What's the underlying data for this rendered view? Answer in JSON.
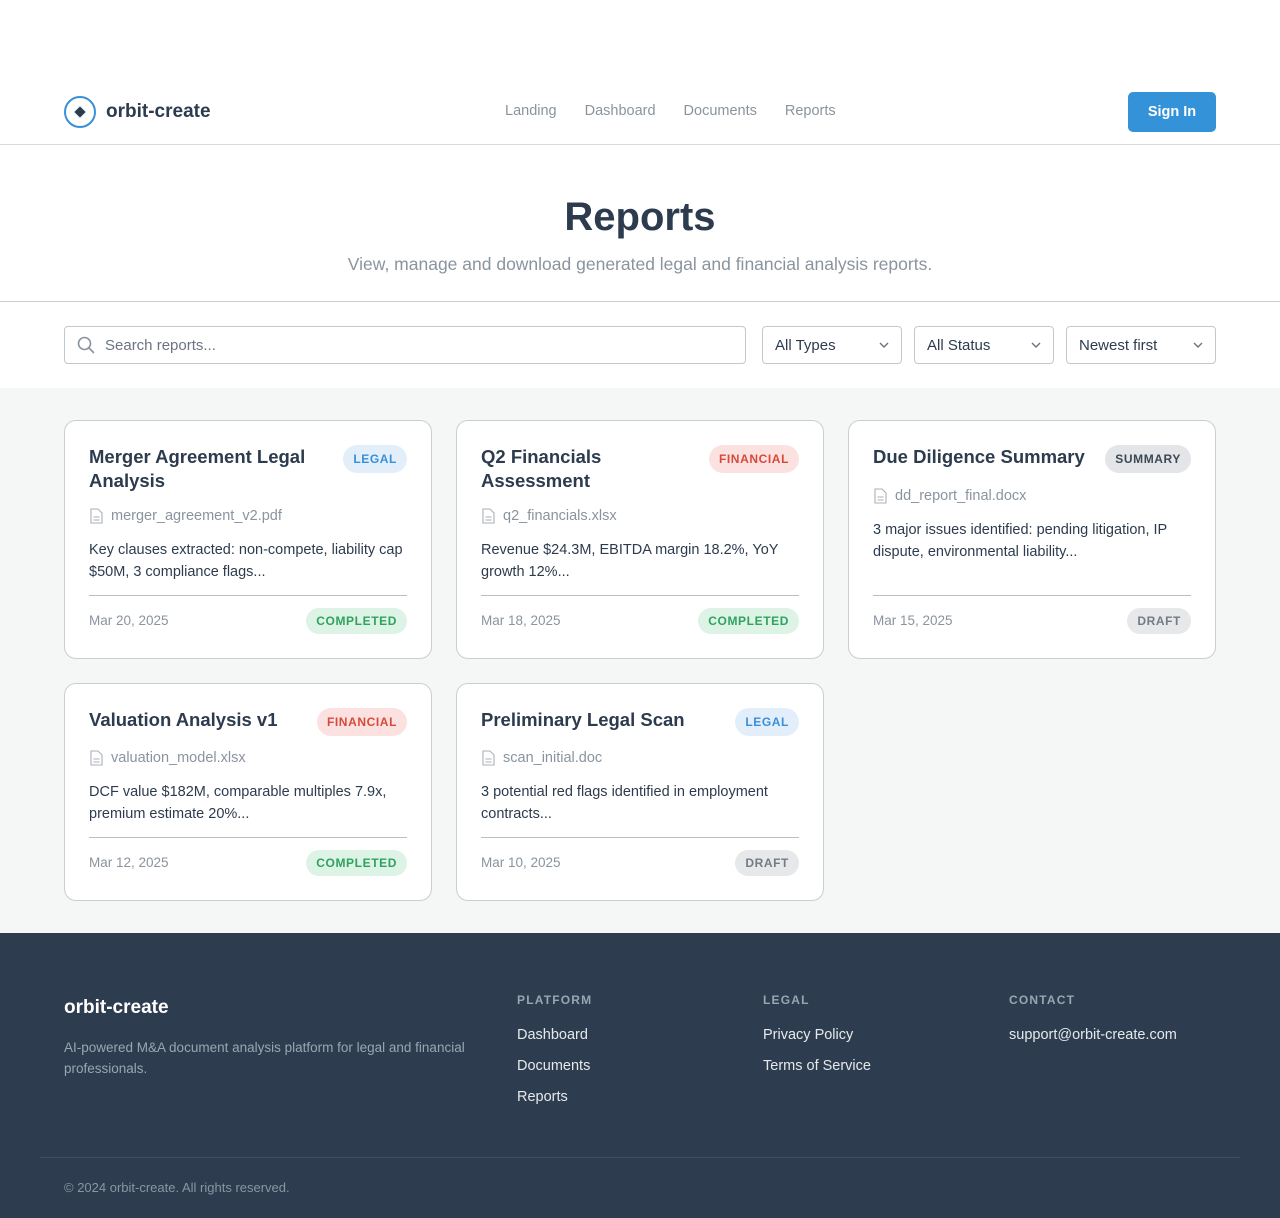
{
  "brand": {
    "name": "orbit-create",
    "accent": "#3492d9"
  },
  "nav": {
    "items": [
      "Landing",
      "Dashboard",
      "Documents",
      "Reports"
    ]
  },
  "header": {
    "signin_label": "Sign In"
  },
  "hero": {
    "title": "Reports",
    "subtitle": "View, manage and download generated legal and financial analysis reports."
  },
  "filters": {
    "search_placeholder": "Search reports...",
    "type_value": "All Types",
    "status_value": "All Status",
    "sort_value": "Newest first"
  },
  "reports": [
    {
      "title_line1": "Merger Agreement Legal",
      "title_line2": "Analysis",
      "badge": "LEGAL",
      "file": "merger_agreement_v2.pdf",
      "desc_line1": "Key clauses extracted: non-compete, liability cap",
      "desc_line2": "$50M, 3 compliance flags...",
      "date": "Mar 20, 2025",
      "status": "COMPLETED"
    },
    {
      "title_line1": "Q2 Financials",
      "title_line2": "Assessment",
      "badge": "FINANCIAL",
      "file": "q2_financials.xlsx",
      "desc_line1": "Revenue $24.3M, EBITDA margin 18.2%, YoY",
      "desc_line2": "growth 12%...",
      "date": "Mar 18, 2025",
      "status": "COMPLETED"
    },
    {
      "title_line1": "Due Diligence Summary",
      "title_line2": "",
      "badge": "SUMMARY",
      "file": "dd_report_final.docx",
      "desc_line1": "3 major issues identified: pending litigation, IP",
      "desc_line2": "dispute, environmental liability...",
      "date": "Mar 15, 2025",
      "status": "DRAFT"
    },
    {
      "title_line1": "Valuation Analysis v1",
      "title_line2": "",
      "badge": "FINANCIAL",
      "file": "valuation_model.xlsx",
      "desc_line1": "DCF value $182M, comparable multiples 7.9x,",
      "desc_line2": "premium estimate 20%...",
      "date": "Mar 12, 2025",
      "status": "COMPLETED"
    },
    {
      "title_line1": "Preliminary Legal Scan",
      "title_line2": "",
      "badge": "LEGAL",
      "file": "scan_initial.doc",
      "desc_line1": "3 potential red flags identified in employment",
      "desc_line2": "contracts...",
      "date": "Mar 10, 2025",
      "status": "DRAFT"
    }
  ],
  "footer": {
    "brand": "orbit-create",
    "description": "AI-powered M&A document analysis platform for legal and financial professionals.",
    "platform": {
      "heading": "PLATFORM",
      "links": [
        "Dashboard",
        "Documents",
        "Reports"
      ]
    },
    "legal": {
      "heading": "LEGAL",
      "links": [
        "Privacy Policy",
        "Terms of Service"
      ]
    },
    "contact": {
      "heading": "CONTACT",
      "email": "support@orbit-create.com"
    },
    "copyright": "© 2024 orbit-create. All rights reserved."
  }
}
